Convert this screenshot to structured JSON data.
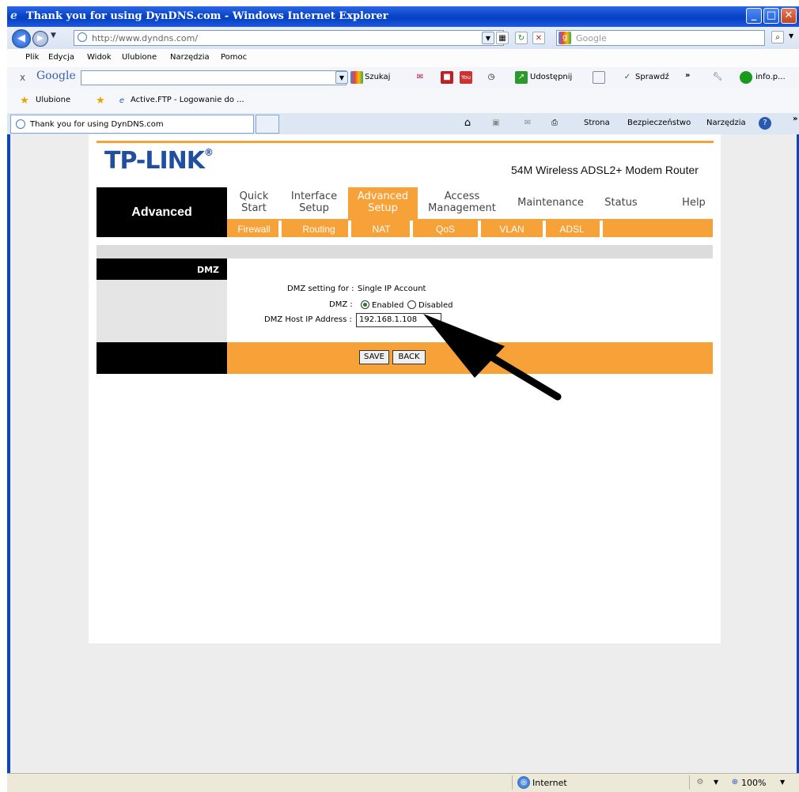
{
  "window": {
    "title": "Thank you for using DynDNS.com - Windows Internet Explorer"
  },
  "address_bar": {
    "url": "http://www.dyndns.com/",
    "search_placeholder": "Google"
  },
  "menu": [
    "Plik",
    "Edycja",
    "Widok",
    "Ulubione",
    "Narzędzia",
    "Pomoc"
  ],
  "google_toolbar": {
    "logo": "Google",
    "szukaj": "Szukaj",
    "udostepnij": "Udostępnij",
    "sprawdz": "Sprawdź",
    "info": "info.p..."
  },
  "favorites_bar": {
    "ulubione": "Ulubione",
    "link1": "Active.FTP - Logowanie do ..."
  },
  "tab_bar": {
    "tab_title": "Thank you for using DynDNS.com",
    "strona": "Strona",
    "bezpieczenstwo": "Bezpieczeństwo",
    "narzedzia": "Narzędzia"
  },
  "router": {
    "logo": "TP-LINK",
    "model": "54M Wireless ADSL2+ Modem Router",
    "section": "Advanced",
    "nav": [
      {
        "line1": "Quick",
        "line2": "Start"
      },
      {
        "line1": "Interface",
        "line2": "Setup"
      },
      {
        "line1": "Advanced",
        "line2": "Setup"
      },
      {
        "line1": "Access",
        "line2": "Management"
      },
      {
        "line1": "Maintenance",
        "line2": ""
      },
      {
        "line1": "Status",
        "line2": ""
      },
      {
        "line1": "Help",
        "line2": ""
      }
    ],
    "subnav": [
      "Firewall",
      "Routing",
      "NAT",
      "QoS",
      "VLAN",
      "ADSL"
    ],
    "dmz_heading": "DMZ",
    "dmz_setting_for_label": "DMZ setting for :",
    "dmz_setting_for_value": "Single IP Account",
    "dmz_label": "DMZ :",
    "enabled": "Enabled",
    "disabled": "Disabled",
    "dmz_enabled": true,
    "host_ip_label": "DMZ Host IP Address :",
    "host_ip_value": "192.168.1.108",
    "save": "SAVE",
    "back": "BACK"
  },
  "status_bar": {
    "zone": "Internet",
    "zoom": "100%"
  }
}
